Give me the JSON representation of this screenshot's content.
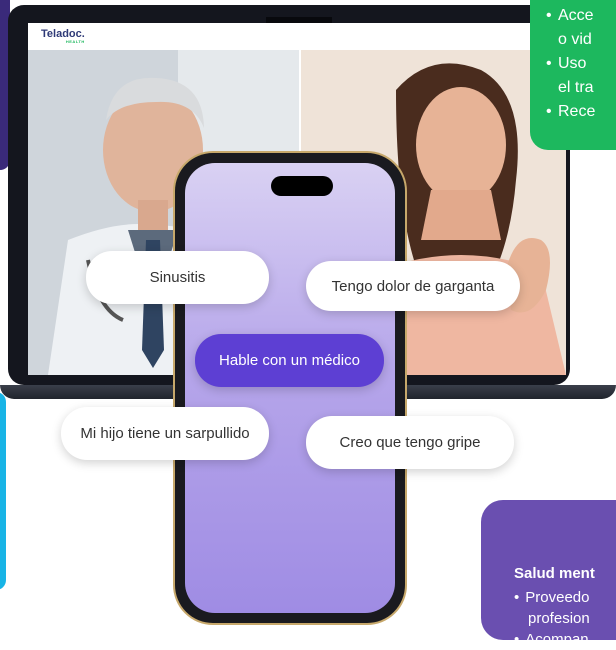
{
  "logo": {
    "brand": "Teladoc.",
    "sub": "HEALTH"
  },
  "green_card": {
    "items": [
      "Acce",
      "o vid",
      "Uso",
      "el tra",
      "Rece"
    ]
  },
  "violet_card": {
    "title": "Salud ment",
    "items": [
      "Proveedo",
      "profesion",
      "Acompan"
    ]
  },
  "chips": {
    "sinusitis": "Sinusitis",
    "sore_throat": "Tengo dolor de garganta",
    "talk_doctor": "Hable con un médico",
    "rash": "Mi hijo tiene un sarpullido",
    "flu": "Creo que tengo gripe"
  },
  "colors": {
    "primary": "#5d3fd3",
    "green": "#1db85e",
    "violet": "#6a4fb0",
    "cyan": "#18b4e6"
  }
}
